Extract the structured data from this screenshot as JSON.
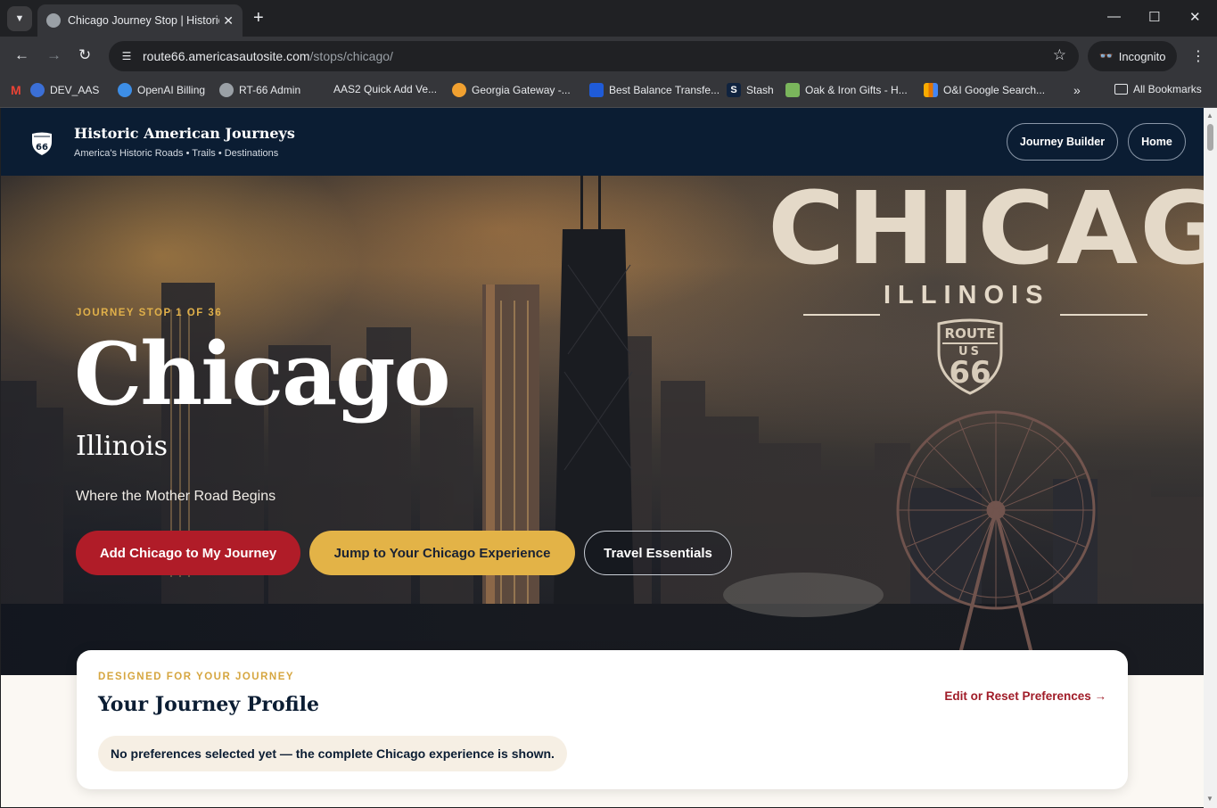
{
  "browser": {
    "tab_title": "Chicago Journey Stop | Historic",
    "url_host": "route66.americasautosite.com",
    "url_path": "/stops/chicago/",
    "incognito_label": "Incognito",
    "bookmarks": [
      {
        "label": "DEV_AAS",
        "icon": "gmail-icon"
      },
      {
        "label": "OpenAI Billing",
        "icon": "openai-icon"
      },
      {
        "label": "RT-66 Admin",
        "icon": "globe-icon"
      },
      {
        "label": "AAS2 Quick Add Ve...",
        "icon": "blank-icon"
      },
      {
        "label": "Georgia Gateway -...",
        "icon": "georgia-icon"
      },
      {
        "label": "Best Balance Transfe...",
        "icon": "flag-icon"
      },
      {
        "label": "Stash",
        "icon": "stash-icon"
      },
      {
        "label": "Oak & Iron Gifts - H...",
        "icon": "shopify-icon"
      },
      {
        "label": "O&I Google Search...",
        "icon": "analytics-icon"
      }
    ],
    "all_bookmarks_label": "All Bookmarks"
  },
  "site": {
    "brand_name": "Historic American Journeys",
    "brand_tagline": "America's Historic Roads • Trails • Destinations",
    "nav": {
      "journey_builder": "Journey Builder",
      "home": "Home"
    }
  },
  "hero": {
    "eyebrow": "JOURNEY STOP 1 OF 36",
    "city": "Chicago",
    "state": "Illinois",
    "tagline": "Where the Mother Road Begins",
    "image_text": {
      "city": "CHICAGO",
      "state": "ILLINOIS",
      "shield_top": "ROUTE",
      "shield_mid": "US",
      "shield_num": "66"
    },
    "buttons": {
      "add": "Add Chicago to My Journey",
      "jump": "Jump to Your Chicago Experience",
      "essentials": "Travel Essentials"
    }
  },
  "profile": {
    "eyebrow": "DESIGNED FOR YOUR JOURNEY",
    "title": "Your Journey Profile",
    "edit_link": "Edit or Reset Preferences →",
    "status": "No preferences selected yet — the complete Chicago experience is shown."
  },
  "colors": {
    "header_navy": "#0b1d33",
    "cta_red": "#b01c28",
    "cta_gold": "#e3b347",
    "eyebrow_gold": "#e0b04a",
    "link_red": "#a01c28"
  }
}
